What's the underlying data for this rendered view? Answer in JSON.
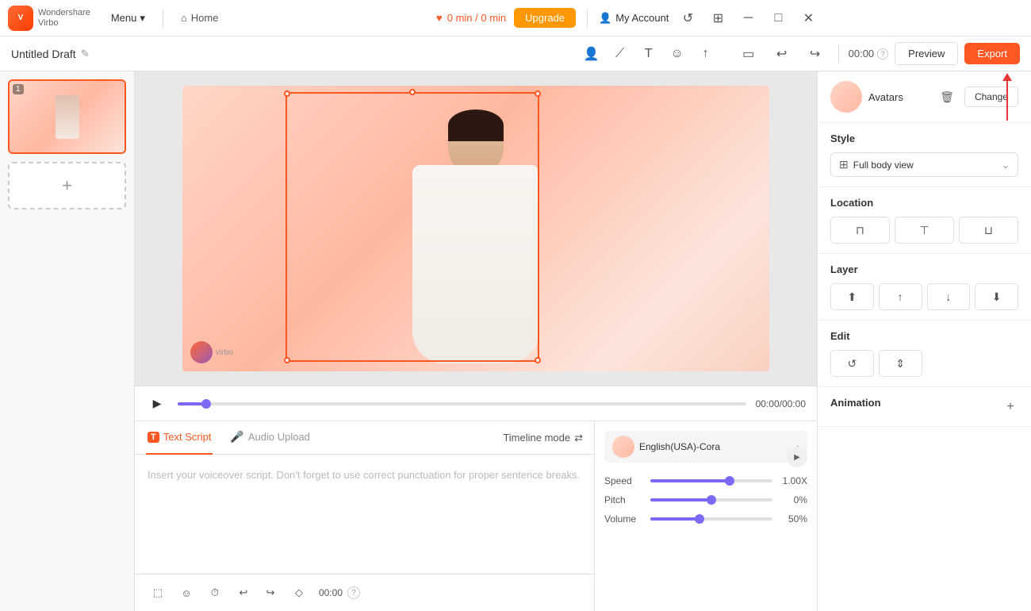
{
  "app": {
    "logo_line1": "Wondershare",
    "logo_line2": "Virbo",
    "menu_label": "Menu",
    "home_label": "Home"
  },
  "topbar": {
    "timer": "0 min / 0 min",
    "upgrade_label": "Upgrade",
    "account_label": "My Account"
  },
  "secondbar": {
    "draft_title": "Untitled Draft",
    "time_display": "00:00",
    "preview_label": "Preview",
    "export_label": "Export"
  },
  "slides": {
    "items": [
      {
        "number": "1",
        "active": true
      }
    ],
    "add_label": "+"
  },
  "playback": {
    "time": "00:00/00:00"
  },
  "script": {
    "text_script_tab": "Text Script",
    "audio_upload_tab": "Audio Upload",
    "timeline_mode": "Timeline mode",
    "placeholder": "Insert your voiceover script. Don't forget to use correct punctuation for proper sentence breaks.",
    "time_display": "00:00"
  },
  "voice": {
    "name": "English(USA)-Cora",
    "speed_label": "Speed",
    "speed_value": "1.00X",
    "speed_percent": 65,
    "pitch_label": "Pitch",
    "pitch_value": "0%",
    "pitch_percent": 50,
    "volume_label": "Volume",
    "volume_value": "50%",
    "volume_percent": 40
  },
  "right_panel": {
    "avatars_label": "Avatars",
    "change_label": "Change",
    "style_label": "Style",
    "full_body_view": "Full body view",
    "location_label": "Location",
    "layer_label": "Layer",
    "edit_label": "Edit",
    "animation_label": "Animation"
  }
}
